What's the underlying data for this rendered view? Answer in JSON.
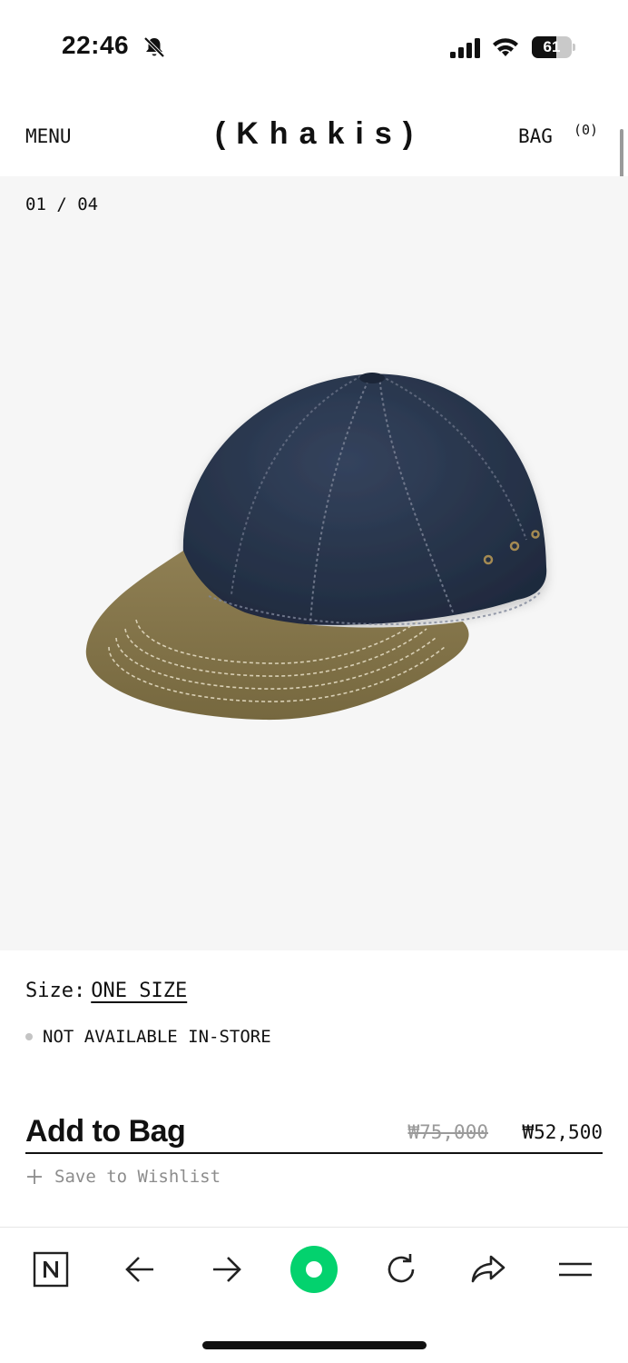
{
  "status_bar": {
    "time": "22:46",
    "battery_level": "61",
    "battery_fraction": 0.61,
    "icons": [
      "bell-slash-icon",
      "cellular-signal-icon",
      "wifi-icon",
      "battery-icon"
    ]
  },
  "header": {
    "menu_label": "MENU",
    "logo": "(Khakis)",
    "bag_label": "BAG",
    "bag_count": "(0)"
  },
  "gallery": {
    "counter": "01 / 04",
    "image_description_icon": "cap-photo",
    "colors": {
      "crown": "#2c3a52",
      "brim": "#8a7a4f",
      "background": "#f6f6f6"
    }
  },
  "product": {
    "size_label": "Size:",
    "size_value": "ONE SIZE",
    "availability": "NOT AVAILABLE IN-STORE",
    "add_to_bag": "Add to Bag",
    "price_original": "₩75,000",
    "price_sale": "₩52,500",
    "wishlist_label": "Save to Wishlist"
  },
  "browser_toolbar": {
    "items": [
      "naver-n-icon",
      "back-arrow-icon",
      "forward-arrow-icon",
      "green-circle-icon",
      "reload-icon",
      "share-icon",
      "menu-lines-icon"
    ],
    "accent": "#03d26e"
  }
}
